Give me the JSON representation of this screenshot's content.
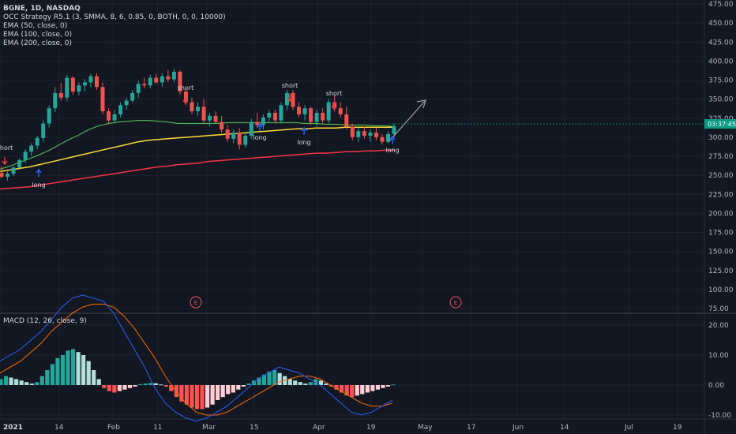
{
  "header": {
    "symbol_line": "BGNE, 1D, NASDAQ",
    "indicators": [
      "OCC Strategy R5.1 (3, SMMA, 8, 6, 0.85, 0, BOTH, 0, 0, 10000)",
      "EMA (50, close, 0)",
      "EMA (100, close, 0)",
      "EMA (200, close, 0)"
    ]
  },
  "macd_pane": {
    "label": "MACD (12, 26, close, 9)"
  },
  "price_badge": {
    "value": "03:37:45"
  },
  "earnings_marker": "E",
  "signals": [
    {
      "label": "short",
      "type": "short"
    },
    {
      "label": "long",
      "type": "long"
    },
    {
      "label": "short",
      "type": "short"
    },
    {
      "label": "long",
      "type": "long"
    },
    {
      "label": "short",
      "type": "short"
    },
    {
      "label": "long",
      "type": "long"
    },
    {
      "label": "short",
      "type": "short"
    },
    {
      "label": "long",
      "type": "long"
    }
  ],
  "colors": {
    "background": "#131722",
    "grid": "#1e222d",
    "up": "#26a69a",
    "down": "#ef5350",
    "ema50": "#4caf50",
    "ema100": "#fdd835",
    "ema200": "#f23645",
    "macd_line": "#2962ff",
    "signal_line": "#ff6d00",
    "badge": "#089981"
  },
  "chart_data": [
    {
      "type": "candlestick",
      "title": "BGNE, 1D, NASDAQ",
      "x_ticks": [
        "2021",
        "14",
        "Feb",
        "11",
        "Mar",
        "15",
        "Apr",
        "19",
        "May",
        "17",
        "Jun",
        "14",
        "Jul",
        "19"
      ],
      "y_ticks": [
        "475.00",
        "450.00",
        "425.00",
        "400.00",
        "375.00",
        "350.00",
        "325.00",
        "300.00",
        "275.00",
        "250.00",
        "225.00",
        "200.00",
        "175.00",
        "150.00",
        "125.00",
        "100.00",
        "75.00"
      ],
      "ylim": [
        75,
        475
      ],
      "ohlc": [
        [
          253,
          262,
          246,
          248
        ],
        [
          248,
          255,
          243,
          252
        ],
        [
          252,
          262,
          249,
          260
        ],
        [
          260,
          272,
          257,
          270
        ],
        [
          270,
          284,
          266,
          281
        ],
        [
          281,
          292,
          276,
          289
        ],
        [
          289,
          302,
          284,
          299
        ],
        [
          299,
          322,
          294,
          318
        ],
        [
          318,
          342,
          313,
          338
        ],
        [
          338,
          366,
          333,
          358
        ],
        [
          358,
          371,
          348,
          352
        ],
        [
          352,
          382,
          347,
          378
        ],
        [
          378,
          380,
          356,
          360
        ],
        [
          360,
          372,
          355,
          368
        ],
        [
          368,
          376,
          360,
          372
        ],
        [
          372,
          383,
          366,
          380
        ],
        [
          380,
          384,
          362,
          366
        ],
        [
          366,
          372,
          330,
          334
        ],
        [
          334,
          338,
          318,
          322
        ],
        [
          322,
          336,
          318,
          330
        ],
        [
          330,
          346,
          326,
          342
        ],
        [
          342,
          352,
          336,
          348
        ],
        [
          348,
          362,
          345,
          358
        ],
        [
          358,
          374,
          352,
          370
        ],
        [
          370,
          378,
          364,
          368
        ],
        [
          368,
          382,
          364,
          378
        ],
        [
          378,
          383,
          370,
          372
        ],
        [
          372,
          384,
          366,
          380
        ],
        [
          380,
          388,
          372,
          376
        ],
        [
          376,
          390,
          372,
          386
        ],
        [
          386,
          388,
          356,
          360
        ],
        [
          360,
          364,
          342,
          346
        ],
        [
          346,
          352,
          330,
          334
        ],
        [
          334,
          346,
          328,
          340
        ],
        [
          340,
          350,
          318,
          322
        ],
        [
          322,
          332,
          314,
          328
        ],
        [
          328,
          334,
          318,
          320
        ],
        [
          320,
          328,
          306,
          310
        ],
        [
          310,
          316,
          294,
          298
        ],
        [
          298,
          310,
          292,
          306
        ],
        [
          306,
          312,
          284,
          290
        ],
        [
          290,
          306,
          286,
          302
        ],
        [
          302,
          324,
          298,
          320
        ],
        [
          320,
          332,
          312,
          316
        ],
        [
          316,
          330,
          310,
          326
        ],
        [
          326,
          336,
          320,
          332
        ],
        [
          332,
          336,
          318,
          322
        ],
        [
          322,
          346,
          318,
          342
        ],
        [
          342,
          362,
          336,
          358
        ],
        [
          358,
          362,
          336,
          340
        ],
        [
          340,
          346,
          326,
          330
        ],
        [
          330,
          342,
          322,
          338
        ],
        [
          338,
          340,
          316,
          320
        ],
        [
          320,
          336,
          314,
          332
        ],
        [
          332,
          338,
          318,
          322
        ],
        [
          322,
          350,
          318,
          346
        ],
        [
          346,
          356,
          334,
          338
        ],
        [
          338,
          346,
          326,
          330
        ],
        [
          330,
          340,
          310,
          314
        ],
        [
          314,
          318,
          296,
          300
        ],
        [
          300,
          312,
          294,
          308
        ],
        [
          308,
          314,
          298,
          302
        ],
        [
          302,
          310,
          294,
          306
        ],
        [
          306,
          312,
          296,
          300
        ],
        [
          300,
          304,
          290,
          294
        ],
        [
          294,
          308,
          292,
          304
        ],
        [
          304,
          318,
          300,
          314
        ]
      ],
      "ema50": [
        258,
        262,
        267,
        272,
        277,
        283,
        290,
        297,
        303,
        310,
        315,
        318,
        320,
        321,
        322,
        322,
        321,
        320,
        318,
        318,
        318,
        318,
        318,
        319,
        319,
        319,
        319,
        319,
        319,
        319,
        319,
        318,
        318,
        317,
        317,
        316,
        316,
        316,
        315,
        315,
        314
      ],
      "ema100": [
        255,
        257,
        259,
        261,
        264,
        267,
        270,
        273,
        276,
        279,
        282,
        285,
        288,
        291,
        294,
        296,
        297,
        298,
        299,
        300,
        301,
        302,
        303,
        304,
        305,
        306,
        307,
        308,
        309,
        310,
        311,
        311,
        312,
        312,
        312,
        313,
        313,
        313,
        313,
        313,
        313
      ],
      "ema200": [
        232,
        233,
        234,
        235,
        237,
        239,
        241,
        243,
        245,
        247,
        249,
        251,
        253,
        255,
        257,
        259,
        261,
        262,
        264,
        265,
        266,
        268,
        269,
        270,
        271,
        272,
        273,
        274,
        275,
        276,
        277,
        278,
        279,
        279,
        280,
        281,
        281,
        282,
        282,
        283,
        283
      ]
    },
    {
      "type": "bar",
      "title": "MACD (12, 26, close, 9)",
      "y_ticks": [
        "20.00",
        "10.00",
        "0.00",
        "-10.00"
      ],
      "ylim": [
        -12,
        24
      ],
      "histogram": [
        2,
        3,
        2.5,
        2,
        1.5,
        1,
        0.5,
        1,
        3,
        5,
        7,
        9,
        10,
        11.5,
        12,
        11,
        10,
        8,
        5,
        2,
        -1,
        -2,
        -2.5,
        -2,
        -1.5,
        -1,
        -0.5,
        0.3,
        0.5,
        0.7,
        0.6,
        0.2,
        -0.5,
        -2,
        -4,
        -5.5,
        -6.5,
        -7.5,
        -8,
        -8,
        -7.5,
        -6.5,
        -5,
        -4,
        -3,
        -2.5,
        -1.5,
        -0.5,
        0.5,
        1.5,
        2.5,
        3.5,
        4.5,
        5,
        4,
        3,
        2,
        1.5,
        1,
        0.5,
        1,
        2,
        1.5,
        0.5,
        -0.5,
        -1.5,
        -2.5,
        -3.5,
        -4,
        -3.5,
        -3,
        -2.5,
        -2,
        -1.5,
        -1,
        -0.5,
        0.2
      ],
      "macd": [
        8,
        10,
        12,
        15,
        18,
        22,
        26,
        29,
        30,
        29,
        28,
        24,
        18,
        12,
        6,
        -1,
        -6,
        -9,
        -11,
        -12,
        -11,
        -9,
        -7,
        -4,
        -1,
        2,
        4,
        6,
        5,
        4,
        2,
        0,
        -3,
        -6,
        -9,
        -10,
        -9,
        -7,
        -5
      ],
      "signal": [
        4,
        6,
        8,
        11,
        14,
        18,
        21,
        24,
        26,
        27,
        27,
        26,
        23,
        19,
        14,
        9,
        3,
        -2,
        -6,
        -9,
        -10,
        -10,
        -9,
        -7,
        -5,
        -3,
        -1,
        1,
        2,
        3,
        3,
        2,
        0,
        -2,
        -4,
        -6,
        -7,
        -7,
        -6
      ]
    }
  ]
}
